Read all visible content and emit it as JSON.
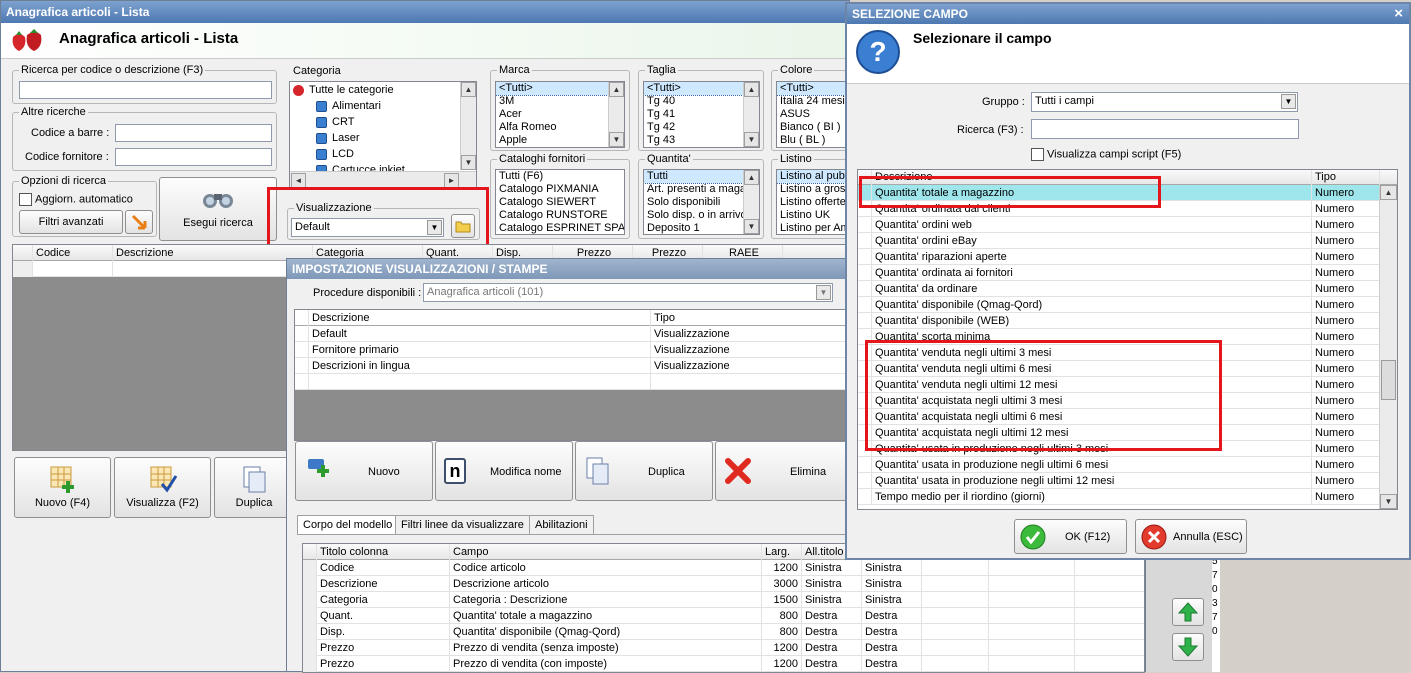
{
  "main": {
    "window_title": "Anagrafica articoli  - Lista",
    "header_title": "Anagrafica articoli  - Lista",
    "search_group": "Ricerca per codice o descrizione (F3)",
    "other_search_group": "Altre ricerche",
    "barcode_label": "Codice a barre :",
    "supplier_code_label": "Codice fornitore :",
    "options_group": "Opzioni di ricerca",
    "auto_update_label": "Aggiorn. automatico",
    "advanced_filters_btn": "Filtri avanzati",
    "search_btn": "Esegui ricerca",
    "category_label": "Categoria",
    "categories": [
      "Tutte le categorie",
      "Alimentari",
      "CRT",
      "Laser",
      "LCD",
      "Cartucce inkjet"
    ],
    "display_group": "Visualizzazione",
    "display_value": "Default",
    "brand_label": "Marca",
    "brands": [
      "<Tutti>",
      "3M",
      "Acer",
      "Alfa Romeo",
      "Apple"
    ],
    "size_label": "Taglia",
    "sizes": [
      "<Tutti>",
      "Tg 40",
      "Tg 41",
      "Tg 42",
      "Tg 43"
    ],
    "color_label": "Colore",
    "colors": [
      "<Tutti>",
      "Italia 24 mesi",
      "ASUS",
      "Bianco ( BI )",
      "Blu ( BL )"
    ],
    "catalog_label": "Cataloghi fornitori",
    "catalogs": [
      "Tutti (F6)",
      "Catalogo PIXMANIA",
      "Catalogo SIEWERT",
      "Catalogo RUNSTORE",
      "Catalogo ESPRINET SPA"
    ],
    "quantity_label": "Quantita'",
    "quantities": [
      "Tutti",
      "Art. presenti a magazzino",
      "Solo disponibili",
      "Solo disp. o in arrivo",
      "Deposito 1"
    ],
    "pricelist_label": "Listino",
    "pricelists": [
      "Listino al pubblico",
      "Listino a grossisti",
      "Listino offerte",
      "Listino UK",
      "Listino per Amazon"
    ],
    "grid_headers": [
      "Codice",
      "Descrizione",
      "Categoria",
      "Quant.",
      "Disp.",
      "Prezzo",
      "Prezzo",
      "RAEE"
    ],
    "bottom_buttons": [
      "Nuovo (F4)",
      "Visualizza (F2)",
      "Duplica"
    ]
  },
  "impostazione": {
    "title": "IMPOSTAZIONE VISUALIZZAZIONI / STAMPE",
    "procedures_label": "Procedure disponibili :",
    "procedures_value": "Anagrafica articoli (101)",
    "list_headers": [
      "Descrizione",
      "Tipo"
    ],
    "list_rows": [
      [
        "Default",
        "Visualizzazione"
      ],
      [
        "Fornitore primario",
        "Visualizzazione"
      ],
      [
        "Descrizioni in lingua",
        "Visualizzazione"
      ]
    ],
    "buttons": [
      "Nuovo",
      "Modifica nome",
      "Duplica",
      "Elimina"
    ],
    "tabs": [
      "Corpo del modello",
      "Filtri linee da visualizzare",
      "Abilitazioni"
    ],
    "col_headers": [
      "Titolo colonna",
      "Campo",
      "Larg.",
      "All.titolo"
    ],
    "col_rows": [
      [
        "Codice",
        "Codice articolo",
        "1200",
        "Sinistra",
        "Sinistra"
      ],
      [
        "Descrizione",
        "Descrizione articolo",
        "3000",
        "Sinistra",
        "Sinistra"
      ],
      [
        "Categoria",
        "Categoria : Descrizione",
        "1500",
        "Sinistra",
        "Sinistra"
      ],
      [
        "Quant.",
        "Quantita' totale a magazzino",
        "800",
        "Destra",
        "Destra"
      ],
      [
        "Disp.",
        "Quantita' disponibile (Qmag-Qord)",
        "800",
        "Destra",
        "Destra"
      ],
      [
        "Prezzo",
        "Prezzo di vendita (senza imposte)",
        "1200",
        "Destra",
        "Destra"
      ],
      [
        "Prezzo",
        "Prezzo di vendita (con imposte)",
        "1200",
        "Destra",
        "Destra"
      ]
    ]
  },
  "selezione": {
    "title": "SELEZIONE CAMPO",
    "close_glyph": "×",
    "heading": "Selezionare il campo",
    "group_label": "Gruppo :",
    "group_value": "Tutti i campi",
    "search_label": "Ricerca (F3) :",
    "script_checkbox": "Visualizza campi script (F5)",
    "headers": [
      "Descrizione",
      "Tipo"
    ],
    "rows": [
      [
        "Quantita' totale a magazzino",
        "Numero"
      ],
      [
        "Quantita' ordinata dai clienti",
        "Numero"
      ],
      [
        "Quantita' ordini web",
        "Numero"
      ],
      [
        "Quantita' ordini eBay",
        "Numero"
      ],
      [
        "Quantita' riparazioni aperte",
        "Numero"
      ],
      [
        "Quantita' ordinata ai fornitori",
        "Numero"
      ],
      [
        "Quantita' da ordinare",
        "Numero"
      ],
      [
        "Quantita' disponibile (Qmag-Qord)",
        "Numero"
      ],
      [
        "Quantita' disponibile (WEB)",
        "Numero"
      ],
      [
        "Quantita' scorta minima",
        "Numero"
      ],
      [
        "Quantita' venduta negli ultimi 3 mesi",
        "Numero"
      ],
      [
        "Quantita' venduta negli ultimi 6 mesi",
        "Numero"
      ],
      [
        "Quantita' venduta negli ultimi 12 mesi",
        "Numero"
      ],
      [
        "Quantita' acquistata negli ultimi 3 mesi",
        "Numero"
      ],
      [
        "Quantita' acquistata negli ultimi 6 mesi",
        "Numero"
      ],
      [
        "Quantita' acquistata negli ultimi 12 mesi",
        "Numero"
      ],
      [
        "Quantita' usata in produzione negli ultimi 3 mesi",
        "Numero"
      ],
      [
        "Quantita' usata in produzione negli ultimi 6 mesi",
        "Numero"
      ],
      [
        "Quantita' usata in produzione negli ultimi 12 mesi",
        "Numero"
      ],
      [
        "Tempo medio per il riordino (giorni)",
        "Numero"
      ]
    ],
    "ok_btn": "OK (F12)",
    "cancel_btn": "Annulla (ESC)"
  },
  "right_strip_digits": [
    "5",
    "7",
    "0",
    "3",
    "7",
    "0"
  ],
  "colors": {
    "highlight_red": "#e4161c",
    "selected_row": "#9fe6ec",
    "title_blue": "#4d78b1"
  }
}
